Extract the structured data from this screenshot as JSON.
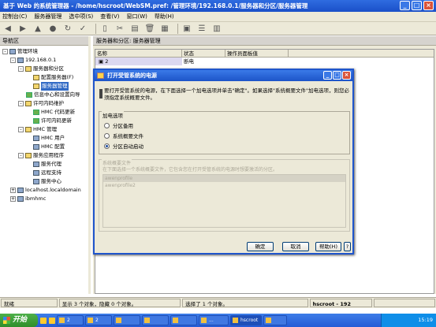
{
  "window": {
    "title": "基于 Web 的系统管理器 - /home/hscroot/WebSM.pref: /管理环境/192.168.0.1/服务器和分区/服务器管理"
  },
  "menubar": [
    "控制台(C)",
    "服务器管理",
    "选中项(S)",
    "查看(V)",
    "窗口(W)",
    "帮助(H)"
  ],
  "nav": {
    "header": "导航区",
    "tree": [
      "管理环境",
      "192.168.0.1",
      "服务器和分区",
      "配置服务器(F)",
      "服务器管理",
      "信息中心和设置向导",
      "许可内码维护",
      "HMC 代码更新",
      "许可内码更新",
      "HMC 管理",
      "HMC 用户",
      "HMC 配置",
      "服务应用程序",
      "服务代理",
      "远程支持",
      "服务中心",
      "localhost.localdomain",
      "ibmhmc"
    ]
  },
  "main": {
    "breadcrumb": "服务器和分区: 服务器管理",
    "columns": [
      "名称",
      "状态",
      "操作员面板值"
    ],
    "row": {
      "name": "2",
      "status": "断电",
      "panel": ""
    }
  },
  "dialog": {
    "title": "打开受管系统的电源",
    "message": "要打开受管系统的电源，在下面选择一个加电选项并单击\"确定\"。如果选择\"系统概要文件\"加电选项，则您必须指定系统概要文件。",
    "power_group": "加电选项",
    "options": [
      "分区备用",
      "系统概要文件",
      "分区自动启动"
    ],
    "selected_option": 2,
    "profile_group": "系统概要文件",
    "profile_desc": "在下面选择一个系统概要文件，它包含您在打开受管系统的电源时想要激活的分区。",
    "profiles": [
      "awenprofile",
      "awenprofile2"
    ],
    "buttons": {
      "ok": "确定",
      "cancel": "取消",
      "help": "帮助(H)",
      "q": "?"
    }
  },
  "status": {
    "ready": "就绪",
    "shown": "显示 3 个对象，隐藏 0 个对象。",
    "selected": "选择了 1 个对象。",
    "user": "hscroot - 192"
  },
  "taskbar": {
    "start": "开始",
    "tasks": [
      "2",
      "2",
      "",
      "",
      "",
      "...",
      "hscroot",
      ""
    ],
    "clock": "15:19"
  }
}
